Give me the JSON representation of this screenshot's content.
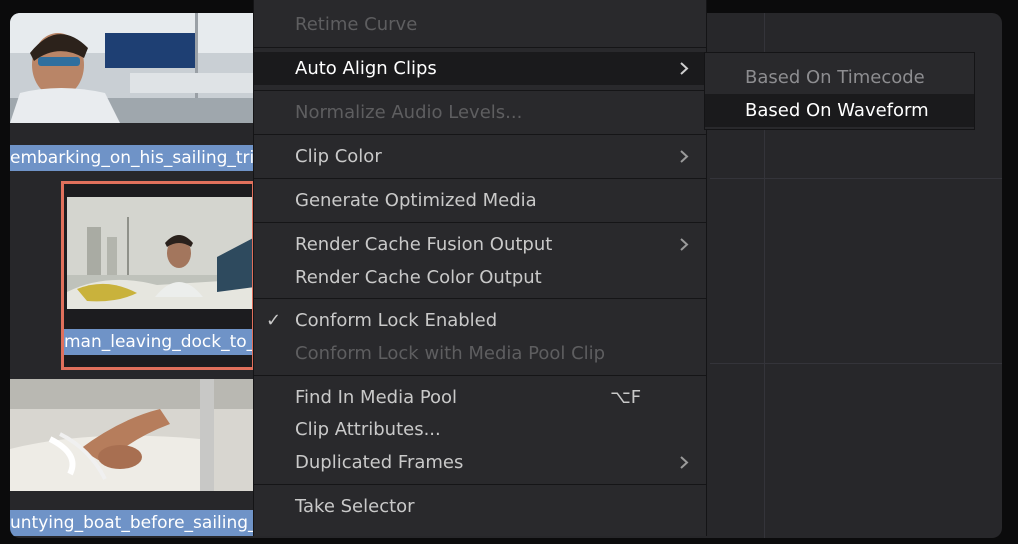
{
  "clips": [
    {
      "name": "embarking_on_his_sailing_trip"
    },
    {
      "name": "man_leaving_dock_to_"
    },
    {
      "name": "untying_boat_before_sailing_b"
    }
  ],
  "context_menu": {
    "items": [
      {
        "label": "Retime Curve"
      },
      {
        "label": "Auto Align Clips",
        "has_submenu": true,
        "state": "active"
      },
      {
        "label": "Normalize Audio Levels..."
      },
      {
        "label": "Clip Color",
        "has_submenu": true
      },
      {
        "label": "Generate Optimized Media"
      },
      {
        "label": "Render Cache Fusion Output",
        "has_submenu": true
      },
      {
        "label": "Render Cache Color Output"
      },
      {
        "label": "Conform Lock Enabled",
        "checked": true
      },
      {
        "label": "Conform Lock with Media Pool Clip",
        "state": "disabled"
      },
      {
        "label": "Find In Media Pool",
        "shortcut": "⌥F"
      },
      {
        "label": "Clip Attributes..."
      },
      {
        "label": "Duplicated Frames",
        "has_submenu": true
      },
      {
        "label": "Take Selector"
      }
    ],
    "check_glyph": "✓"
  },
  "submenu": {
    "items": [
      {
        "label": "Based On Timecode",
        "state": "disabled"
      },
      {
        "label": "Based On Waveform",
        "state": "highlighted"
      }
    ]
  },
  "colors": {
    "clip_name_bg": "#6f93c7",
    "selected_clip_border": "#e0705c",
    "menu_bg": "#29292c"
  }
}
